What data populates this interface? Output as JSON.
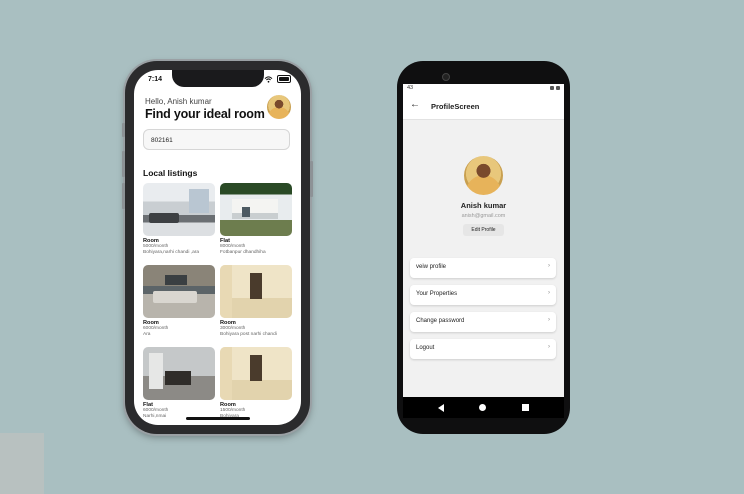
{
  "iphone": {
    "status_time": "7:14",
    "greeting": "Hello, Anish kumar",
    "headline": "Find your ideal room",
    "search_value": "802161",
    "section_title": "Local listings",
    "listings": [
      {
        "type": "Room",
        "price": "5000/month",
        "address": "Bohiyara,narhi chandi ,ara",
        "photo": "living-room"
      },
      {
        "type": "Flat",
        "price": "8000/month",
        "address": "Fotbanpur dhandhiha",
        "photo": "house-exterior"
      },
      {
        "type": "Room",
        "price": "6000/month",
        "address": "Ara",
        "photo": "bedroom"
      },
      {
        "type": "Room",
        "price": "3000/month",
        "address": "Bohiyara post narhi chandi",
        "photo": "empty-room"
      },
      {
        "type": "Flat",
        "price": "6000/month",
        "address": "Narhi,nmai",
        "photo": "dining-room"
      },
      {
        "type": "Room",
        "price": "1500/month",
        "address": "Bohiyara",
        "photo": "empty-room"
      }
    ]
  },
  "android": {
    "status_time": "43",
    "title": "ProfileScreen",
    "name": "Anish kumar",
    "email": "anish@gmail.com",
    "edit_label": "Edit Profile",
    "menu": [
      {
        "label": "veiw profile"
      },
      {
        "label": "Your Properties"
      },
      {
        "label": "Change password"
      },
      {
        "label": "Logout"
      }
    ]
  }
}
